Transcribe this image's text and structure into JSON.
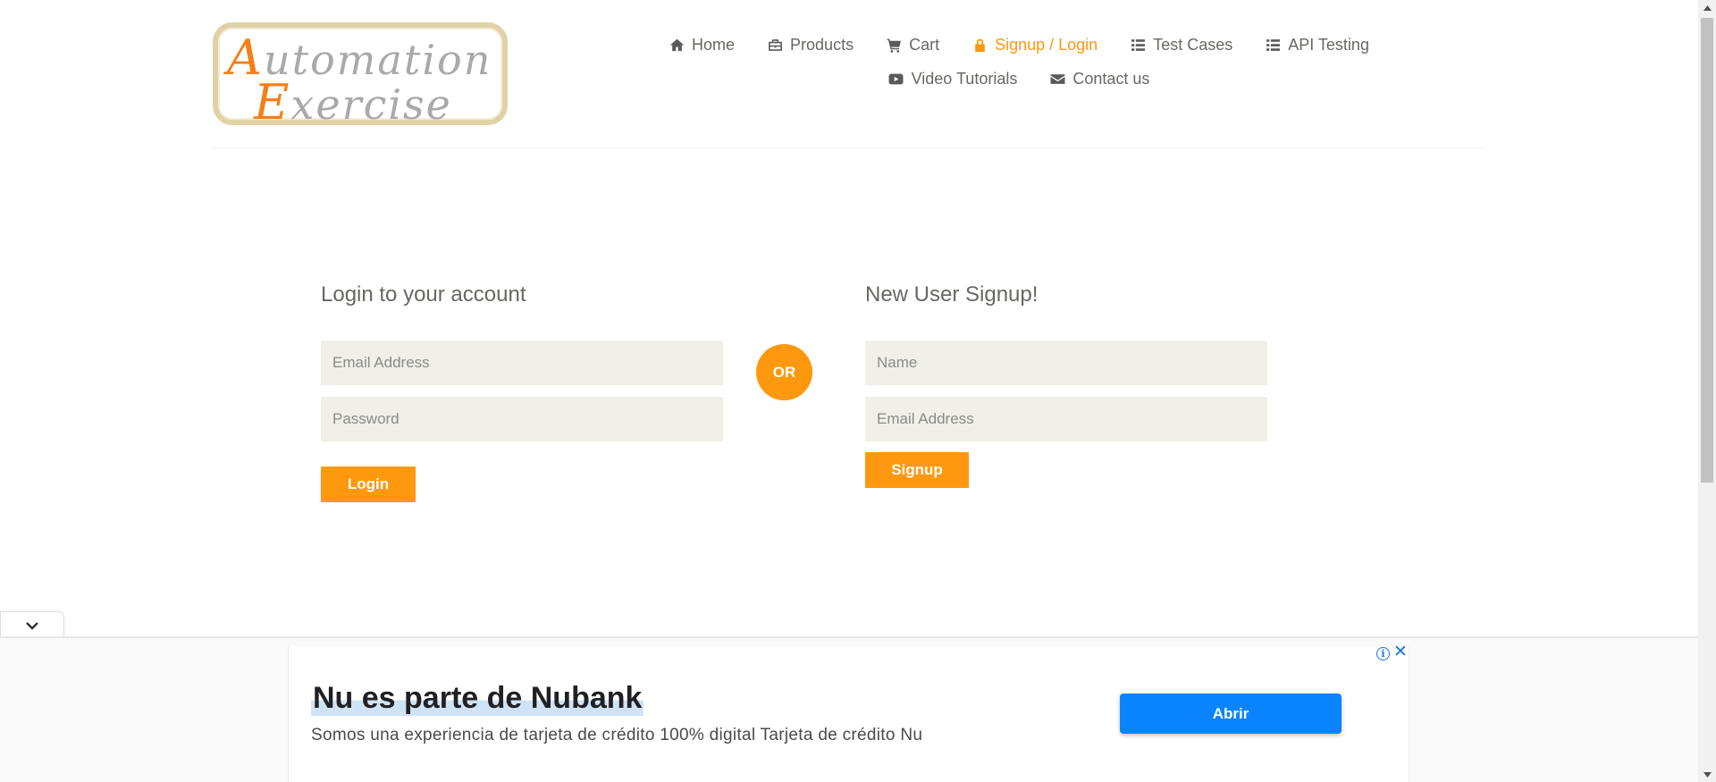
{
  "brand": {
    "logo_line1_cap": "A",
    "logo_line1_rest": "utomation",
    "logo_line2_cap": "E",
    "logo_line2_rest": "xercise",
    "logo_cap_color": "#f57f17",
    "logo_text_color": "#a9a9a9"
  },
  "nav": {
    "row1": [
      {
        "label": "Home",
        "icon": "home-icon"
      },
      {
        "label": "Products",
        "icon": "briefcase-icon"
      },
      {
        "label": "Cart",
        "icon": "cart-icon"
      },
      {
        "label": "Signup / Login",
        "icon": "lock-icon",
        "active": true
      },
      {
        "label": "Test Cases",
        "icon": "list-icon"
      },
      {
        "label": "API Testing",
        "icon": "list-icon"
      }
    ],
    "row2": [
      {
        "label": "Video Tutorials",
        "icon": "youtube-icon"
      },
      {
        "label": "Contact us",
        "icon": "envelope-icon"
      }
    ],
    "active_color": "#fe980f"
  },
  "login": {
    "title": "Login to your account",
    "email_placeholder": "Email Address",
    "password_placeholder": "Password",
    "button_label": "Login"
  },
  "divider": {
    "label": "OR"
  },
  "signup": {
    "title": "New User Signup!",
    "name_placeholder": "Name",
    "email_placeholder": "Email Address",
    "button_label": "Signup"
  },
  "ad": {
    "headline": "Nu es parte de Nubank",
    "subtext": "Somos una experiencia de tarjeta de crédito 100% digital Tarjeta de crédito Nu",
    "cta_label": "Abrir",
    "info_symbol": "i",
    "close_symbol": "✕",
    "cta_color": "#0a84ff"
  },
  "colors": {
    "accent": "#fe980f",
    "input_bg": "#f0f0e9",
    "text": "#696763"
  }
}
